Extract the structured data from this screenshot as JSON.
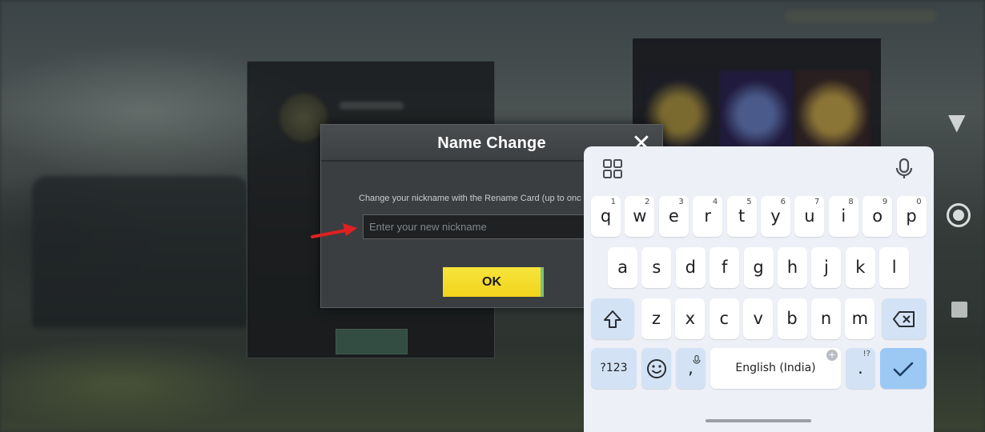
{
  "dialog": {
    "title": "Name Change",
    "close_label": "✕",
    "instruction": "Change your nickname with the Rename Card (up to onc",
    "input_placeholder": "Enter your new nickname",
    "ok_label": "OK"
  },
  "keyboard": {
    "row1": [
      {
        "label": "q",
        "hint": "1"
      },
      {
        "label": "w",
        "hint": "2"
      },
      {
        "label": "e",
        "hint": "3"
      },
      {
        "label": "r",
        "hint": "4"
      },
      {
        "label": "t",
        "hint": "5"
      },
      {
        "label": "y",
        "hint": "6"
      },
      {
        "label": "u",
        "hint": "7"
      },
      {
        "label": "i",
        "hint": "8"
      },
      {
        "label": "o",
        "hint": "9"
      },
      {
        "label": "p",
        "hint": "0"
      }
    ],
    "row2": [
      "a",
      "s",
      "d",
      "f",
      "g",
      "h",
      "j",
      "k",
      "l"
    ],
    "row3": [
      "z",
      "x",
      "c",
      "v",
      "b",
      "n",
      "m"
    ],
    "symbols_label": "?123",
    "comma_label": ",",
    "space_label": "English (India)",
    "period_label": ".",
    "period_hint": "!?",
    "icons": {
      "grid": "apps-grid-icon",
      "mic": "microphone-icon",
      "shift": "shift-icon",
      "backspace": "backspace-icon",
      "emoji": "emoji-icon",
      "enter": "checkmark-icon"
    }
  },
  "colors": {
    "ok_button": "#f2d41c",
    "keyboard_bg": "#edf0f6",
    "function_key": "#d3e3f5",
    "enter_key": "#9cc8f4",
    "annotation_arrow": "#e02020"
  }
}
